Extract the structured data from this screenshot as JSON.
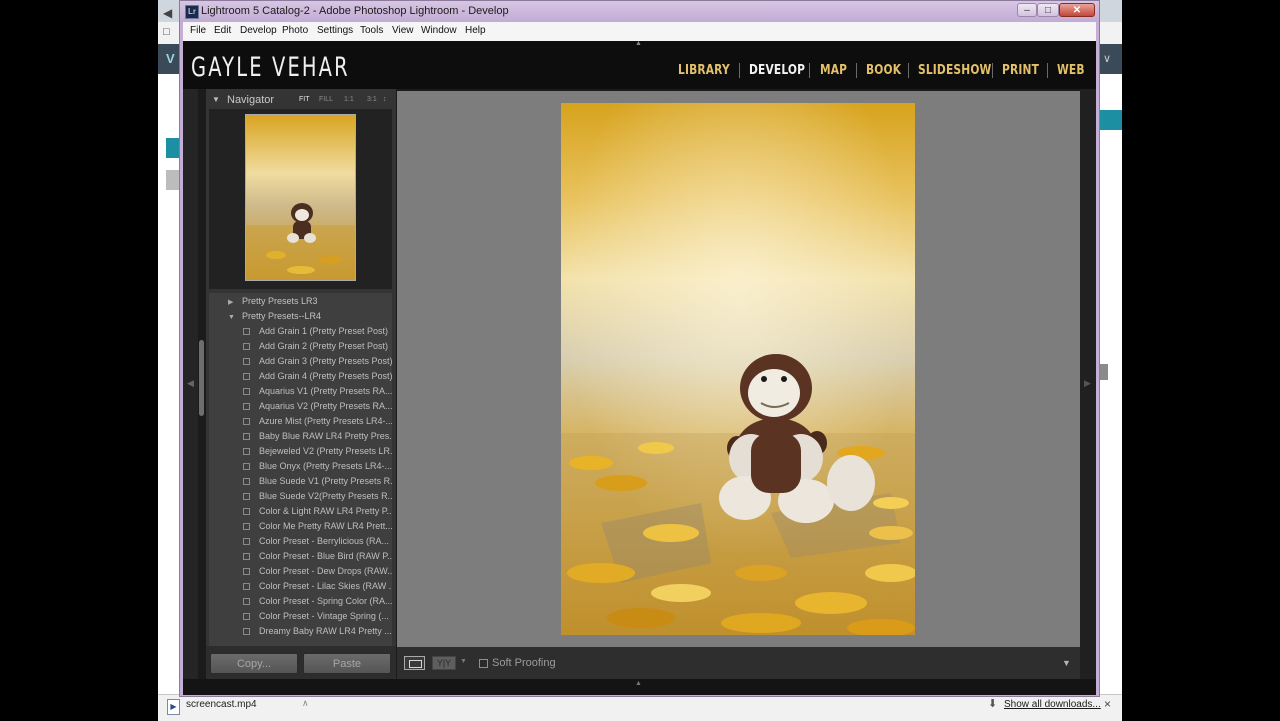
{
  "window": {
    "title": "Lightroom 5 Catalog-2 - Adobe Photoshop Lightroom - Develop",
    "app_icon": "Lr",
    "controls": {
      "minimize": "–",
      "maximize": "□",
      "close": "✕"
    }
  },
  "menu": [
    "File",
    "Edit",
    "Develop",
    "Photo",
    "Settings",
    "Tools",
    "View",
    "Window",
    "Help"
  ],
  "identity_plate": "GAYLE VEHAR",
  "modules": [
    "LIBRARY",
    "DEVELOP",
    "MAP",
    "BOOK",
    "SLIDESHOW",
    "PRINT",
    "WEB"
  ],
  "active_module": "DEVELOP",
  "navigator": {
    "title": "Navigator",
    "zoom": [
      "FIT",
      "FILL",
      "1:1",
      "3:1"
    ],
    "active_zoom": "FIT",
    "zoom_arrow": "↕"
  },
  "presets": {
    "folders": [
      {
        "label": "Pretty Presets LR3",
        "expanded": false,
        "tri": "▶"
      },
      {
        "label": "Pretty Presets--LR4",
        "expanded": true,
        "tri": "▼"
      }
    ],
    "items": [
      "Add Grain 1 (Pretty Preset Post)",
      "Add Grain 2 (Pretty Preset Post)",
      "Add Grain 3 (Pretty Presets Post)",
      "Add Grain 4 (Pretty Presets Post)",
      "Aquarius V1 (Pretty Presets RA...",
      "Aquarius V2 (Pretty Presets RA...",
      "Azure Mist (Pretty Presets LR4-...",
      "Baby Blue RAW LR4 Pretty Pres...",
      "Bejeweled V2 (Pretty Presets LR...",
      "Blue Onyx (Pretty Presets LR4-...",
      "Blue Suede V1 (Pretty Presets R...",
      "Blue Suede V2(Pretty Presets R...",
      "Color & Light RAW LR4 Pretty P...",
      "Color Me Pretty RAW LR4 Prett...",
      "Color Preset - Berrylicious (RA...",
      "Color Preset - Blue Bird (RAW P...",
      "Color Preset - Dew Drops (RAW...",
      "Color Preset - Lilac Skies (RAW ...",
      "Color Preset - Spring Color (RA...",
      "Color Preset - Vintage Spring (...",
      "Dreamy Baby RAW LR4 Pretty ..."
    ],
    "copy_label": "Copy...",
    "paste_label": "Paste"
  },
  "toolbar": {
    "yy_label": "Y|Y",
    "soft_proofing_label": "Soft Proofing",
    "soft_proofing_checked": false,
    "dropdown": "▼"
  },
  "downloads": {
    "file": "screencast.mp4",
    "show_all": "Show all downloads...",
    "close": "×"
  },
  "colors": {
    "module_inactive": "#e3c06a",
    "module_active": "#f2f2f2",
    "panel_bg": "#343434",
    "center_bg": "#7d7d7d"
  }
}
